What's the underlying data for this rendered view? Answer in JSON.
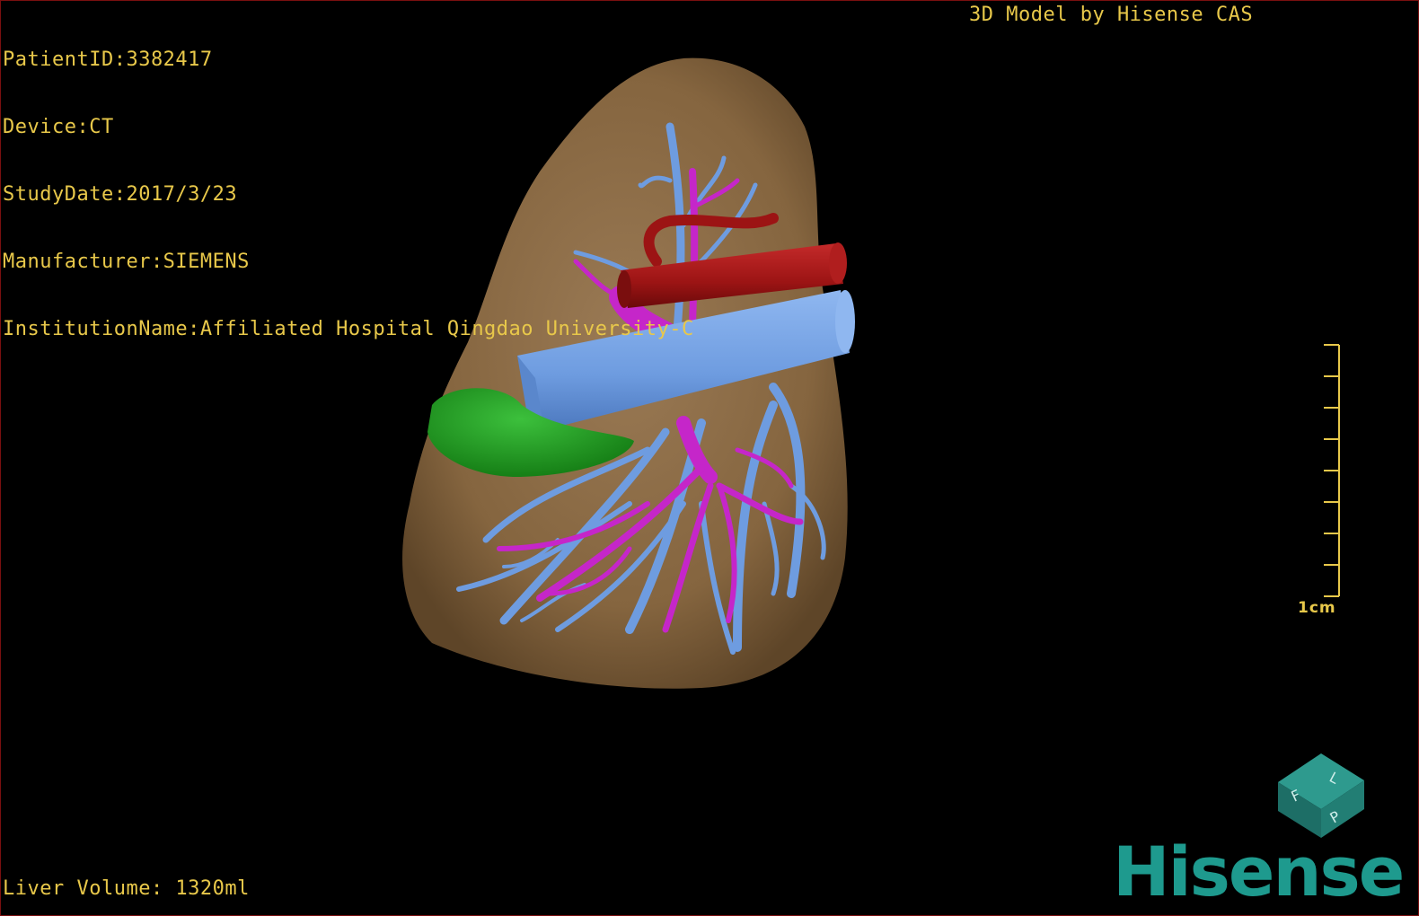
{
  "patient": {
    "id_label": "PatientID:3382417",
    "device_label": "Device:CT",
    "study_date_label": "StudyDate:2017/3/23",
    "manufacturer_label": "Manufacturer:SIEMENS",
    "institution_label": "InstitutionName:Affiliated Hospital Qingdao University-C"
  },
  "credit": "3D Model by Hisense CAS",
  "liver_volume_label": "Liver Volume: 1320ml",
  "scale": {
    "label": "1cm",
    "ticks": 9
  },
  "orientation_cube": {
    "faces": [
      "F",
      "L",
      "P"
    ]
  },
  "brand": "Hisense",
  "colors": {
    "text": "#e8c84a",
    "liver": "#8b6a48",
    "portal_vein": "#c526c9",
    "hepatic_vein": "#6e9ce0",
    "artery": "#9c1414",
    "gallbladder": "#1c9e1c",
    "brand": "#1e9a8e"
  }
}
